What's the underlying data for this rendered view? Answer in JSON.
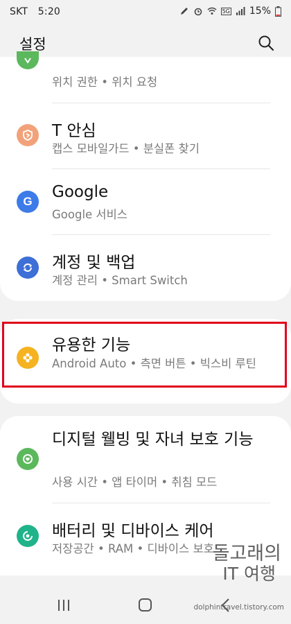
{
  "status_bar": {
    "carrier": "SKT",
    "time": "5:20",
    "battery": "15%",
    "network_badge": "5G"
  },
  "header": {
    "title": "설정",
    "search_icon": "search-icon"
  },
  "settings_items": [
    {
      "title": "",
      "subtitle": "위치 권한 • 위치 요청",
      "icon": "location-icon",
      "color": "#5cb85c"
    },
    {
      "title": "T 안심",
      "subtitle": "캡스 모바일가드 • 분실폰 찾기",
      "icon": "shield-icon",
      "color": "#f2a27a"
    },
    {
      "title": "Google",
      "subtitle": "Google 서비스",
      "icon": "google-icon",
      "color": "#3d7be8"
    },
    {
      "title": "계정 및 백업",
      "subtitle": "계정 관리 • Smart Switch",
      "icon": "sync-icon",
      "color": "#3d6fd6"
    },
    {
      "title": "유용한 기능",
      "subtitle": "Android Auto • 측면 버튼 • 빅스비 루틴",
      "icon": "puzzle-icon",
      "color": "#f5b321"
    },
    {
      "title": "디지털 웰빙 및 자녀 보호 기능",
      "subtitle": "사용 시간 • 앱 타이머 • 취침 모드",
      "icon": "wellbeing-icon",
      "color": "#5cb85c"
    },
    {
      "title": "배터리 및 디바이스 케어",
      "subtitle": "저장공간 • RAM • 디바이스 보호",
      "icon": "device-care-icon",
      "color": "#1fb38a"
    }
  ],
  "navigation_bar": {
    "buttons": [
      "recent-apps-icon",
      "home-icon",
      "back-icon"
    ]
  },
  "watermark": {
    "line1": "돌고래의",
    "line2": "IT 여행",
    "url": "dolphintravel.tistory.com"
  }
}
